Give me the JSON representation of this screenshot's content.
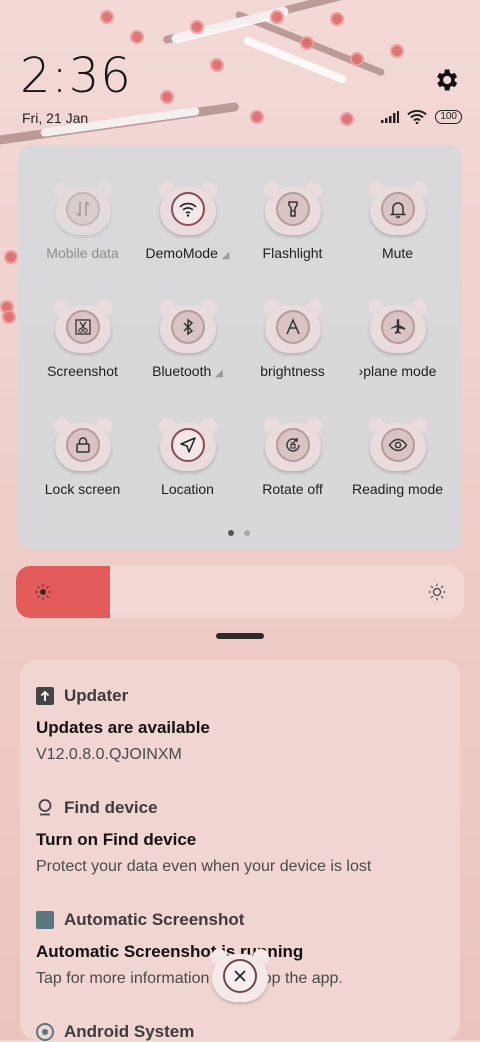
{
  "status": {
    "time": "2:36",
    "date": "Fri, 21 Jan",
    "battery": "100",
    "icons": [
      "signal-icon",
      "wifi-icon",
      "battery-icon"
    ],
    "settings_icon": "gear-icon"
  },
  "quick_settings": {
    "tiles": [
      {
        "label": "Mobile data",
        "icon": "mobile-data-icon",
        "state": "disabled"
      },
      {
        "label": "DemoMode",
        "icon": "wifi-icon",
        "state": "active"
      },
      {
        "label": "Flashlight",
        "icon": "flashlight-icon",
        "state": "off"
      },
      {
        "label": "Mute",
        "icon": "bell-icon",
        "state": "off"
      },
      {
        "label": "Screenshot",
        "icon": "scissors-icon",
        "state": "off"
      },
      {
        "label": "Bluetooth",
        "icon": "bluetooth-icon",
        "state": "off"
      },
      {
        "label": "brightness",
        "icon": "auto-brightness-icon",
        "state": "off"
      },
      {
        "label": "›plane mode",
        "icon": "airplane-icon",
        "state": "off"
      },
      {
        "label": "Lock screen",
        "icon": "lock-icon",
        "state": "off"
      },
      {
        "label": "Location",
        "icon": "location-arrow-icon",
        "state": "active"
      },
      {
        "label": "Rotate off",
        "icon": "rotate-lock-icon",
        "state": "off"
      },
      {
        "label": "Reading mode",
        "icon": "eye-icon",
        "state": "off"
      }
    ],
    "page_indicator": {
      "current": 1,
      "total": 2
    }
  },
  "brightness": {
    "level": 0.21,
    "accent": "#e35b5b"
  },
  "notifications": [
    {
      "app": "Updater",
      "icon": "upload-icon",
      "title": "Updates are available",
      "text": "V12.0.8.0.QJOINXM"
    },
    {
      "app": "Find device",
      "icon": "location-pin-icon",
      "title": "Turn on Find device",
      "text": "Protect your data even when your device is lost"
    },
    {
      "app": "Automatic Screenshot",
      "icon": "app-square-icon",
      "title": "Automatic Screenshot is running",
      "text": "Tap for more information or to stop the app."
    },
    {
      "app": "Android System",
      "icon": "android-icon",
      "title": "",
      "text": ""
    }
  ],
  "close_button": {
    "icon": "close-icon"
  }
}
